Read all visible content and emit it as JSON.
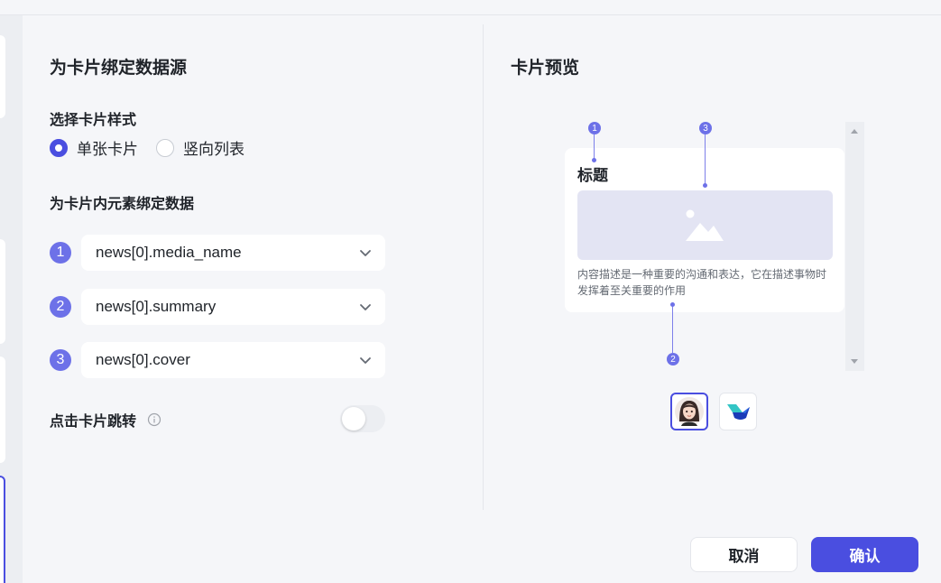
{
  "left_panel": {
    "title": "为卡片绑定数据源",
    "style_label": "选择卡片样式",
    "style_options": [
      {
        "label": "单张卡片",
        "checked": true
      },
      {
        "label": "竖向列表",
        "checked": false
      }
    ],
    "bind_label": "为卡片内元素绑定数据",
    "bindings": [
      {
        "num": "1",
        "value": "news[0].media_name"
      },
      {
        "num": "2",
        "value": "news[0].summary"
      },
      {
        "num": "3",
        "value": "news[0].cover"
      }
    ],
    "jump_label": "点击卡片跳转",
    "jump_enabled": false
  },
  "right_panel": {
    "title": "卡片预览",
    "card": {
      "title": "标题",
      "description": "内容描述是一种重要的沟通和表达，它在描述事物时发挥着至关重要的作用"
    },
    "markers": [
      "1",
      "3",
      "2"
    ]
  },
  "footer": {
    "cancel_label": "取消",
    "confirm_label": "确认"
  },
  "colors": {
    "accent": "#4a4ee0",
    "badge": "#6d71e8",
    "background": "#f5f6f9"
  }
}
